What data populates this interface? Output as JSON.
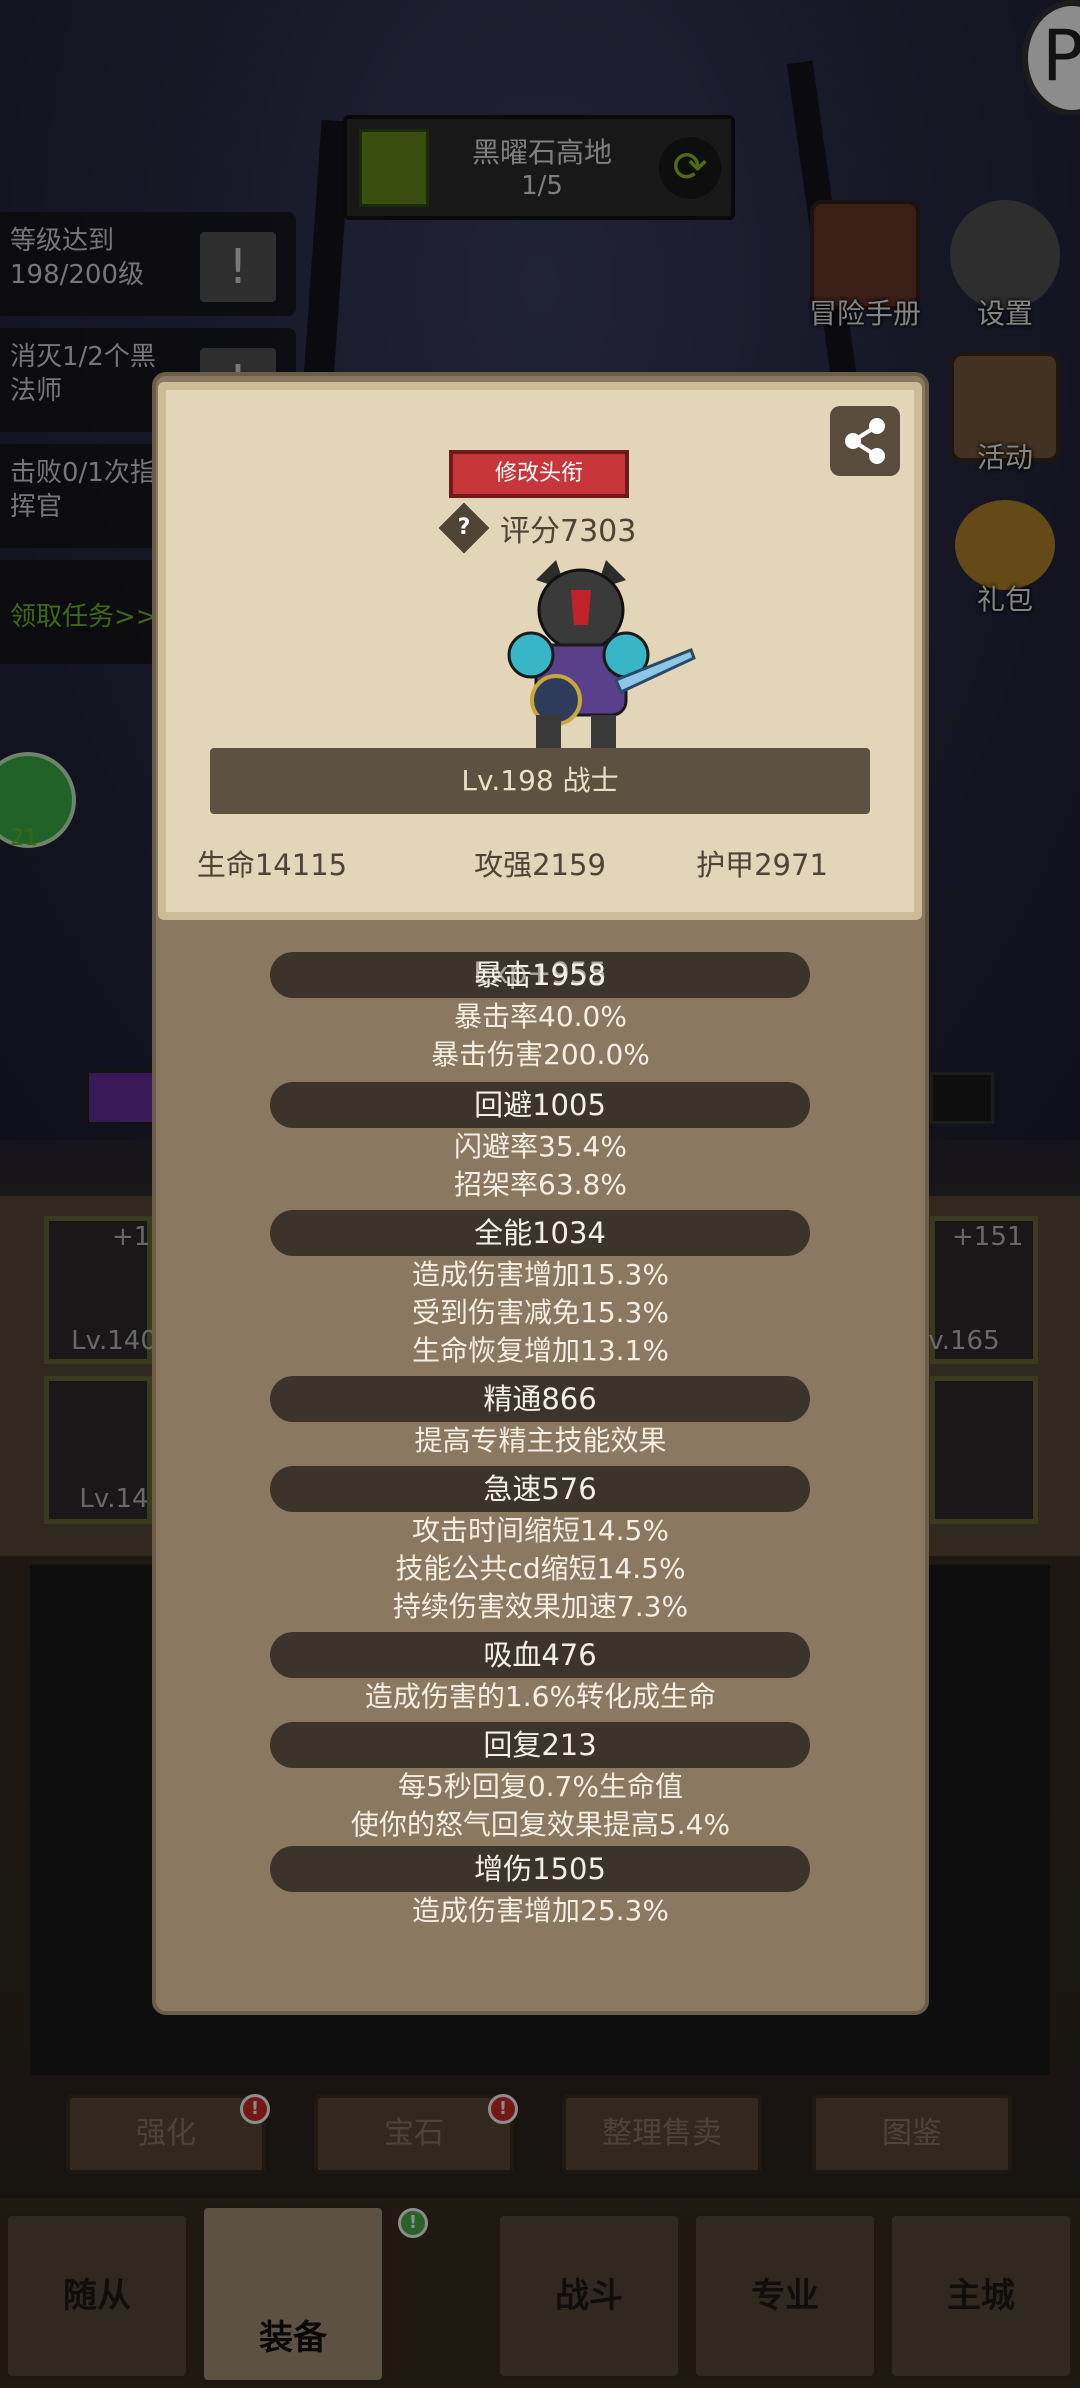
{
  "location": {
    "name": "黑曜石高地",
    "progress": "1/5"
  },
  "quests": [
    {
      "text": "等级达到198/200级"
    },
    {
      "text": "消灭1/2个黑法师"
    },
    {
      "text": "击败0/1次指挥官"
    }
  ],
  "quest_claim": "领取任务>>",
  "side_menu": {
    "adventure_manual": "冒险手册",
    "settings": "设置",
    "events": "活动",
    "gift": "礼包"
  },
  "chat_badge": "21",
  "equipment": {
    "left_top_plus": "+1",
    "left_top_lv": "Lv.140",
    "left_bottom_lv": "Lv.14",
    "right_top_plus": "+151",
    "right_top_lv": "v.165"
  },
  "actions": {
    "enhance": "强化",
    "gem": "宝石",
    "sort_sell": "整理售卖",
    "codex": "图鉴"
  },
  "bottom_nav": {
    "followers": "随从",
    "equipment": "装备",
    "battle": "战斗",
    "profession": "专业",
    "main_city": "主城"
  },
  "modal": {
    "edit_title_button": "修改头衔",
    "score_hint": "?",
    "score": "评分7303",
    "level_class": "Lv.198 战士",
    "hp": "生命14115",
    "attack": "攻强2159",
    "armor": "护甲2971",
    "sections": [
      {
        "header": "暴击1958",
        "overlap": "Exp+955",
        "lines": [
          "暴击率40.0%",
          "暴击伤害200.0%"
        ]
      },
      {
        "header": "回避1005",
        "lines": [
          "闪避率35.4%",
          "招架率63.8%"
        ]
      },
      {
        "header": "全能1034",
        "lines": [
          "造成伤害增加15.3%",
          "受到伤害减免15.3%",
          "生命恢复增加13.1%"
        ]
      },
      {
        "header": "精通866",
        "lines": [
          "提高专精主技能效果"
        ]
      },
      {
        "header": "急速576",
        "lines": [
          "攻击时间缩短14.5%",
          "技能公共cd缩短14.5%",
          "持续伤害效果加速7.3%"
        ]
      },
      {
        "header": "吸血476",
        "lines": [
          "造成伤害的1.6%转化成生命"
        ]
      },
      {
        "header": "回复213",
        "lines": [
          "每5秒回复0.7%生命值",
          "使你的怒气回复效果提高5.4%"
        ]
      },
      {
        "header": "增伤1505",
        "lines": [
          "造成伤害增加25.3%"
        ]
      }
    ]
  },
  "colors": {
    "modal_bg": "#8a7860",
    "modal_top_bg": "#e3d6b8",
    "stat_bar": "#3c342b",
    "title_button": "#c7363a"
  }
}
